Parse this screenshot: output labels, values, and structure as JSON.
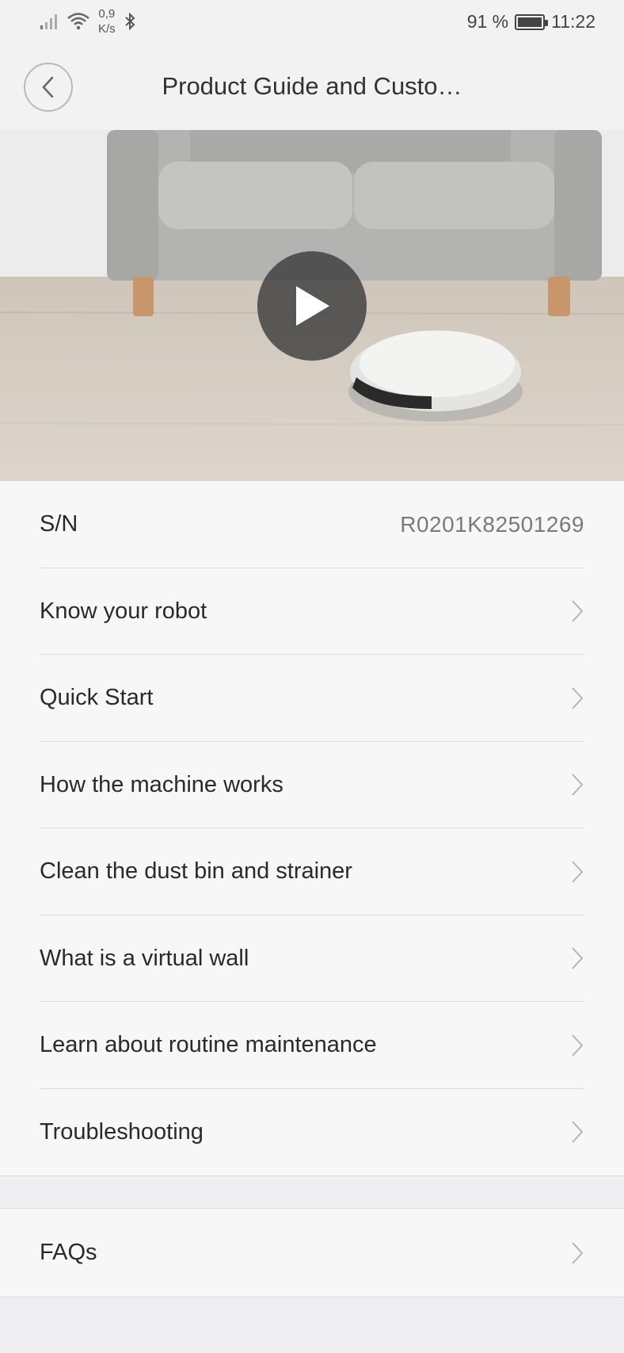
{
  "status_bar": {
    "speed_value": "0,9",
    "speed_unit": "K/s",
    "battery_percent": "91 %",
    "time": "11:22",
    "icons": [
      "signal-icon",
      "wifi-icon",
      "bluetooth-icon",
      "battery-icon"
    ]
  },
  "header": {
    "title": "Product Guide and Custo…",
    "back_icon": "chevron-left-icon"
  },
  "video": {
    "play_icon": "play-icon"
  },
  "serial": {
    "label": "S/N",
    "value": "R0201K82501269"
  },
  "menu": {
    "items": [
      {
        "label": "Know your robot"
      },
      {
        "label": "Quick Start"
      },
      {
        "label": "How the machine works"
      },
      {
        "label": "Clean the dust bin and strainer"
      },
      {
        "label": "What is a virtual wall"
      },
      {
        "label": "Learn about routine maintenance"
      },
      {
        "label": "Troubleshooting"
      }
    ]
  },
  "faq": {
    "label": "FAQs"
  },
  "colors": {
    "background": "#f7f7f7",
    "header_bg": "#f2f2f2",
    "divider": "#dcdcdc",
    "section_gap": "#efeff1",
    "text_primary": "#2a2a2a",
    "text_secondary": "#7a7a7a",
    "chevron": "#b5b5b5"
  }
}
